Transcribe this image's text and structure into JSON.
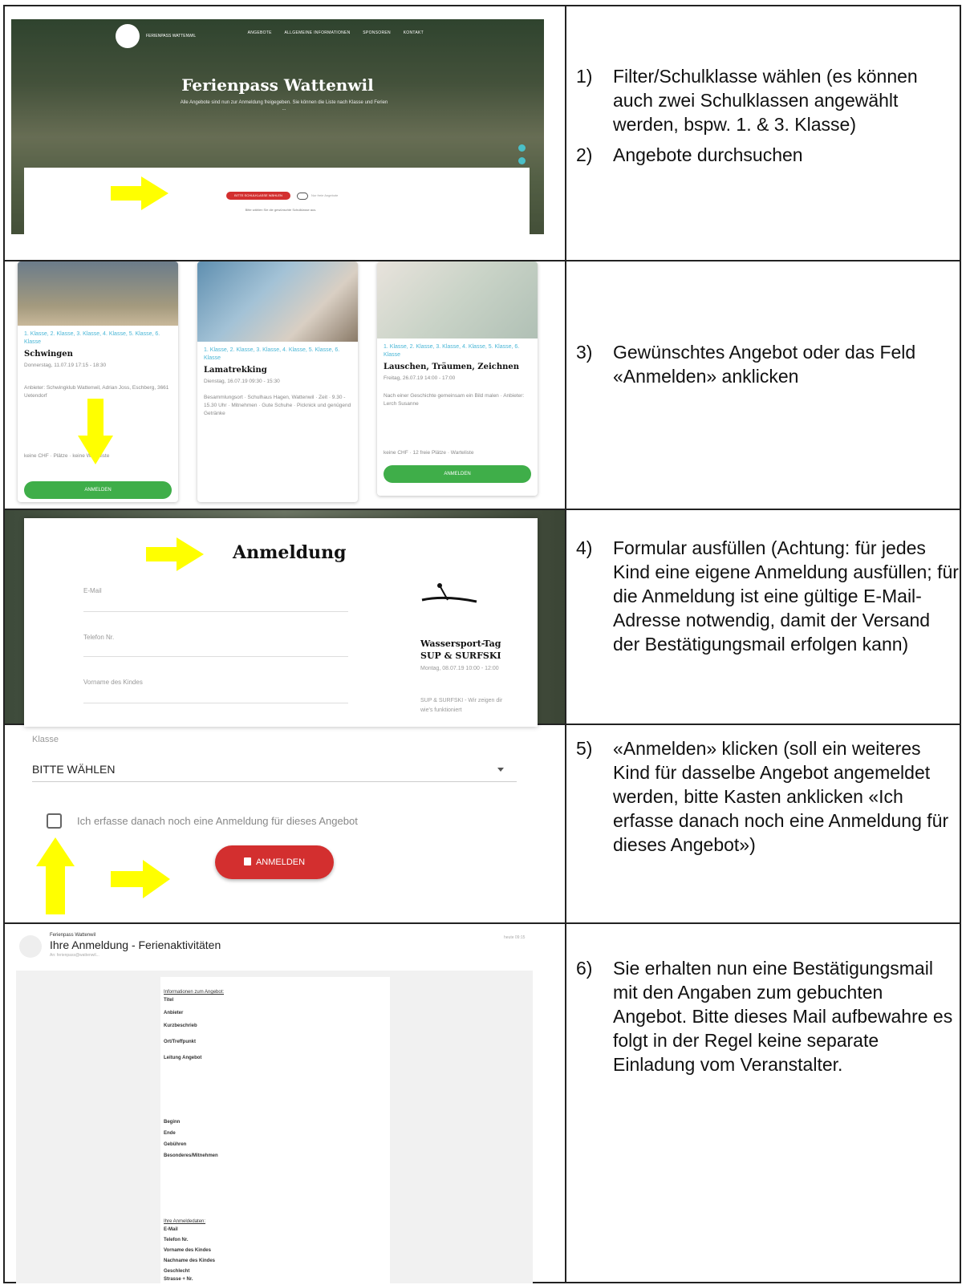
{
  "steps": [
    {
      "num": "1)",
      "text": "Filter/Schulklasse wählen (es können auch zwei Schulklassen angewählt werden, bspw. 1. & 3. Klasse)"
    },
    {
      "num": "2)",
      "text": "Angebote durchsuchen"
    },
    {
      "num": "3)",
      "text": "Gewünschtes Angebot oder das Feld «Anmelden» anklicken"
    },
    {
      "num": "4)",
      "text": "Formular ausfüllen (Achtung: für jedes Kind eine eigene Anmeldung ausfüllen; für die Anmeldung ist eine gültige E-Mail-Adresse notwendig, damit der Versand der Bestätigungsmail erfolgen kann)"
    },
    {
      "num": "5)",
      "text": "«Anmelden» klicken (soll ein weiteres Kind für dasselbe Angebot angemeldet werden, bitte Kasten anklicken «Ich erfasse danach noch eine Anmeldung für dieses Angebot»)"
    },
    {
      "num": "6)",
      "text": "Sie erhalten nun eine Bestätigungsmail mit den Angaben zum gebuchten Angebot. Bitte dieses Mail aufbewahre es folgt in der Regel keine separate Einladung vom Veranstalter."
    }
  ],
  "hero": {
    "title": "Ferienpass Wattenwil",
    "subtitle": "Alle Angebote sind nun zur Anmeldung freigegeben. Sie können die Liste nach Klasse und Ferien ...",
    "logo_text": "FERIENPASS WATTENWIL",
    "nav": [
      "ANGEBOTE",
      "ALLGEMEINE INFORMATIONEN",
      "SPONSOREN",
      "KONTAKT"
    ],
    "filter_button": "BITTE SCHULKLASSE WÄHLEN",
    "toggle_label": "Nur freie Angebote",
    "hint": "Bitte wählen Sie die gewünschte Schulklasse aus."
  },
  "cards": [
    {
      "classes": "1. Klasse, 2. Klasse, 3. Klasse, 4. Klasse, 5. Klasse, 6. Klasse",
      "title": "Schwingen",
      "date": "Donnerstag, 11.07.19 17:15 - 18:30",
      "provider": "Anbieter: Schwingklub Wattenwil, Adrian Joss, Eschberg, 3661 Uetendorf",
      "footer": "keine CHF · Plätze · keine Warteliste",
      "button": "ANMELDEN"
    },
    {
      "classes": "1. Klasse, 2. Klasse, 3. Klasse, 4. Klasse, 5. Klasse, 6. Klasse",
      "title": "Lamatrekking",
      "date": "Dienstag, 16.07.19 09:30 - 15:30",
      "provider": "Besammlungsort · Schulhaus Hagen, Wattenwil · Zeit · 9.30 - 15.30 Uhr · Mitnehmen · Gute Schuhe · Picknick und genügend Getränke",
      "footer": "",
      "button": ""
    },
    {
      "classes": "1. Klasse, 2. Klasse, 3. Klasse, 4. Klasse, 5. Klasse, 6. Klasse",
      "title": "Lauschen, Träumen, Zeichnen",
      "date": "Freitag, 26.07.19 14:00 - 17:00",
      "provider": "Nach einer Geschichte gemeinsam ein Bild malen · Anbieter: Lerch Susanne",
      "footer": "keine CHF · 12 freie Plätze · Warteliste",
      "button": "ANMELDEN"
    }
  ],
  "form": {
    "title": "Anmeldung",
    "fields": [
      "E-Mail",
      "Telefon Nr.",
      "Vorname des Kindes"
    ],
    "side_title_1": "Wassersport-Tag",
    "side_title_2": "SUP & SURFSKI",
    "side_date": "Montag, 08.07.19 10:00 - 12:00",
    "side_desc": "SUP & SURFSKI - Wir zeigen dir wie's funktioniert"
  },
  "signup": {
    "class_label": "Klasse",
    "class_select": "BITTE WÄHLEN",
    "checkbox_label": "Ich erfasse danach noch eine Anmeldung für dieses Angebot",
    "button": "ANMELDEN"
  },
  "mail": {
    "from": "Ferienpass Wattenwil",
    "subject": "Ihre Anmeldung - Ferienaktivitäten",
    "to": "An: ferienpass@wattenwil...",
    "date": "heute 09:15",
    "lines": [
      "Informationen zum Angebot:",
      "Titel",
      "Anbieter",
      "Kurzbeschrieb",
      "Ort/Treffpunkt",
      "Leitung Angebot",
      "Beginn",
      "Ende",
      "Gebühren",
      "Besonderes/Mitnehmen",
      "Ihre Anmeldedaten:",
      "E-Mail",
      "Telefon Nr.",
      "Vorname des Kindes",
      "Nachname des Kindes",
      "Geschlecht",
      "Strasse + Nr."
    ]
  }
}
